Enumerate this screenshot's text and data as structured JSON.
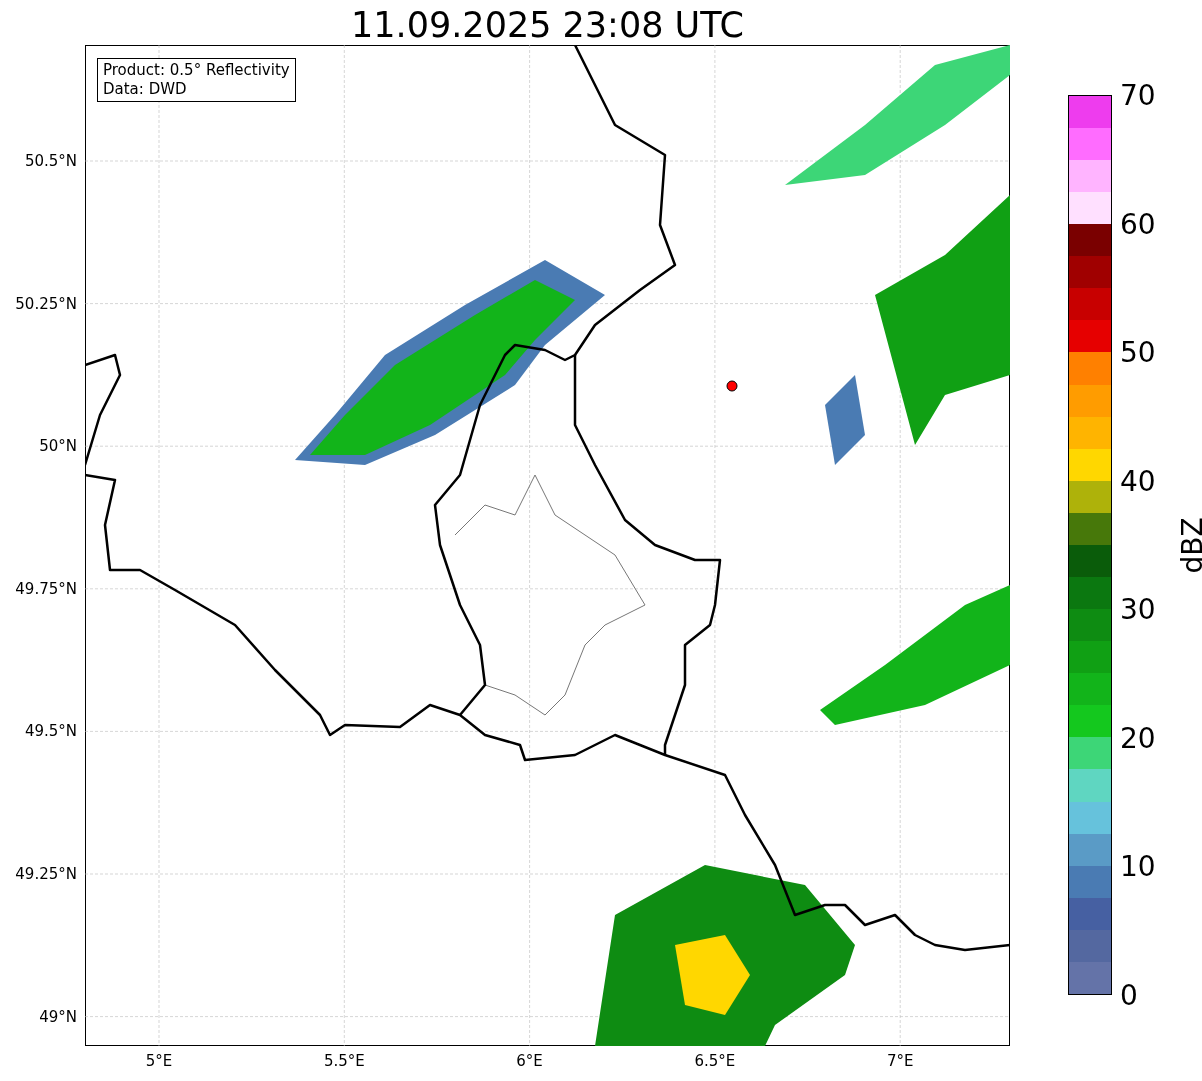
{
  "title": "11.09.2025 23:08 UTC",
  "legend_box": {
    "lines": [
      "Product: 0.5° Reflectivity",
      "Data: DWD"
    ]
  },
  "map": {
    "xticks": [
      "5°E",
      "5.5°E",
      "6°E",
      "6.5°E",
      "7°E"
    ],
    "yticks": [
      "50.5°N",
      "50.25°N",
      "50°N",
      "49.75°N",
      "49.5°N",
      "49.25°N",
      "49°N"
    ]
  },
  "colorbar": {
    "label": "dBZ",
    "ticks": [
      "70",
      "60",
      "50",
      "40",
      "30",
      "20",
      "10",
      "0"
    ],
    "bands": [
      {
        "color": "#6473a8"
      },
      {
        "color": "#5468a0"
      },
      {
        "color": "#4660a2"
      },
      {
        "color": "#4a7bb3"
      },
      {
        "color": "#5a9bc6"
      },
      {
        "color": "#66c2dc"
      },
      {
        "color": "#5fd6c1"
      },
      {
        "color": "#3dd677"
      },
      {
        "color": "#14c81e"
      },
      {
        "color": "#12b41a"
      },
      {
        "color": "#10a014"
      },
      {
        "color": "#0e8c12"
      },
      {
        "color": "#0b7810"
      },
      {
        "color": "#0a5c0a"
      },
      {
        "color": "#47780a"
      },
      {
        "color": "#aeb20a"
      },
      {
        "color": "#ffd700"
      },
      {
        "color": "#ffb400"
      },
      {
        "color": "#ff9c00"
      },
      {
        "color": "#ff8000"
      },
      {
        "color": "#e60000"
      },
      {
        "color": "#c80000"
      },
      {
        "color": "#a00000"
      },
      {
        "color": "#7a0000"
      },
      {
        "color": "#ffe0ff"
      },
      {
        "color": "#ffb4ff"
      },
      {
        "color": "#ff6cff"
      },
      {
        "color": "#ee3cee"
      }
    ]
  }
}
